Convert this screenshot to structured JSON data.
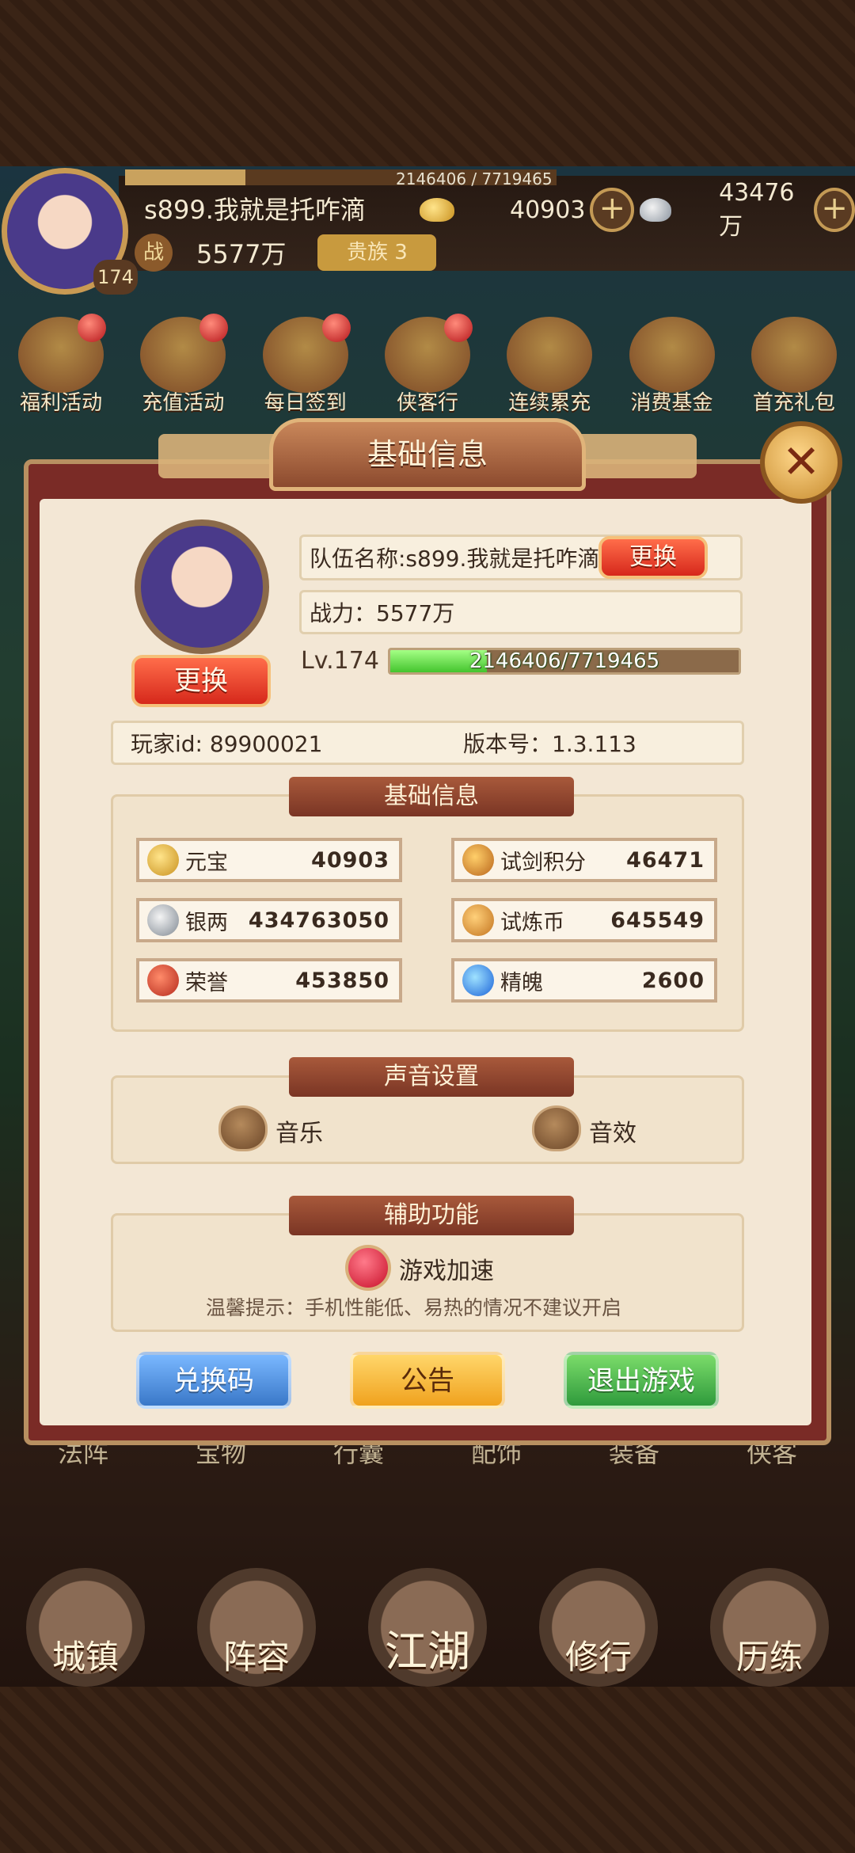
{
  "topbar": {
    "exp_text": "2146406 / 7719465",
    "exp_fraction": 0.278,
    "player_name": "s899.我就是托咋滴",
    "gold": "40903",
    "silver": "43476万",
    "power_icon": "战",
    "power": "5577万",
    "vip": "贵族 3",
    "level": "174"
  },
  "activities": [
    {
      "label": "福利活动",
      "icon": "welfare-icon",
      "dot": true
    },
    {
      "label": "充值活动",
      "icon": "recharge-icon",
      "dot": true
    },
    {
      "label": "每日签到",
      "icon": "signin-icon",
      "dot": true
    },
    {
      "label": "侠客行",
      "icon": "hero-journey-icon",
      "dot": true
    },
    {
      "label": "连续累充",
      "icon": "accumulate-icon",
      "dot": false
    },
    {
      "label": "消费基金",
      "icon": "fund-icon",
      "dot": false
    },
    {
      "label": "首充礼包",
      "icon": "first-recharge-icon",
      "dot": false
    }
  ],
  "modal": {
    "title": "基础信息",
    "change_avatar": "更换",
    "team_name": "队伍名称:s899.我就是托咋滴",
    "change_name": "更换",
    "power_line": "战力：5577万",
    "level_label": "Lv.174",
    "level_exp_text": "2146406/7719465",
    "level_exp_fraction": 0.278,
    "player_id": "玩家id: 89900021",
    "version": "版本号：1.3.113",
    "section_basic": "基础信息",
    "currencies": [
      {
        "name": "元宝",
        "value": "40903",
        "icon": "gold-ingot-icon"
      },
      {
        "name": "试剑积分",
        "value": "46471",
        "icon": "trial-points-icon"
      },
      {
        "name": "银两",
        "value": "434763050",
        "icon": "silver-ingot-icon"
      },
      {
        "name": "试炼币",
        "value": "645549",
        "icon": "trial-coin-icon"
      },
      {
        "name": "荣誉",
        "value": "453850",
        "icon": "honor-icon"
      },
      {
        "name": "精魄",
        "value": "2600",
        "icon": "soul-icon"
      }
    ],
    "section_sound": "声音设置",
    "music": "音乐",
    "sfx": "音效",
    "section_assist": "辅助功能",
    "speedup": "游戏加速",
    "tip": "温馨提示：手机性能低、易热的情况不建议开启",
    "btn_redeem": "兑换码",
    "btn_notice": "公告",
    "btn_exit": "退出游戏"
  },
  "sub_row": [
    "法阵",
    "宝物",
    "行囊",
    "配饰",
    "装备",
    "侠客"
  ],
  "nav": [
    "城镇",
    "阵容",
    "江湖",
    "修行",
    "历练"
  ],
  "colors": {
    "modal_frame": "#7a2b26",
    "panel": "#f3e7d5",
    "exp_green": "#44c42e",
    "btn_blue": "#4a8ad8",
    "btn_yellow": "#f5b52a",
    "btn_green": "#3fae4a"
  }
}
